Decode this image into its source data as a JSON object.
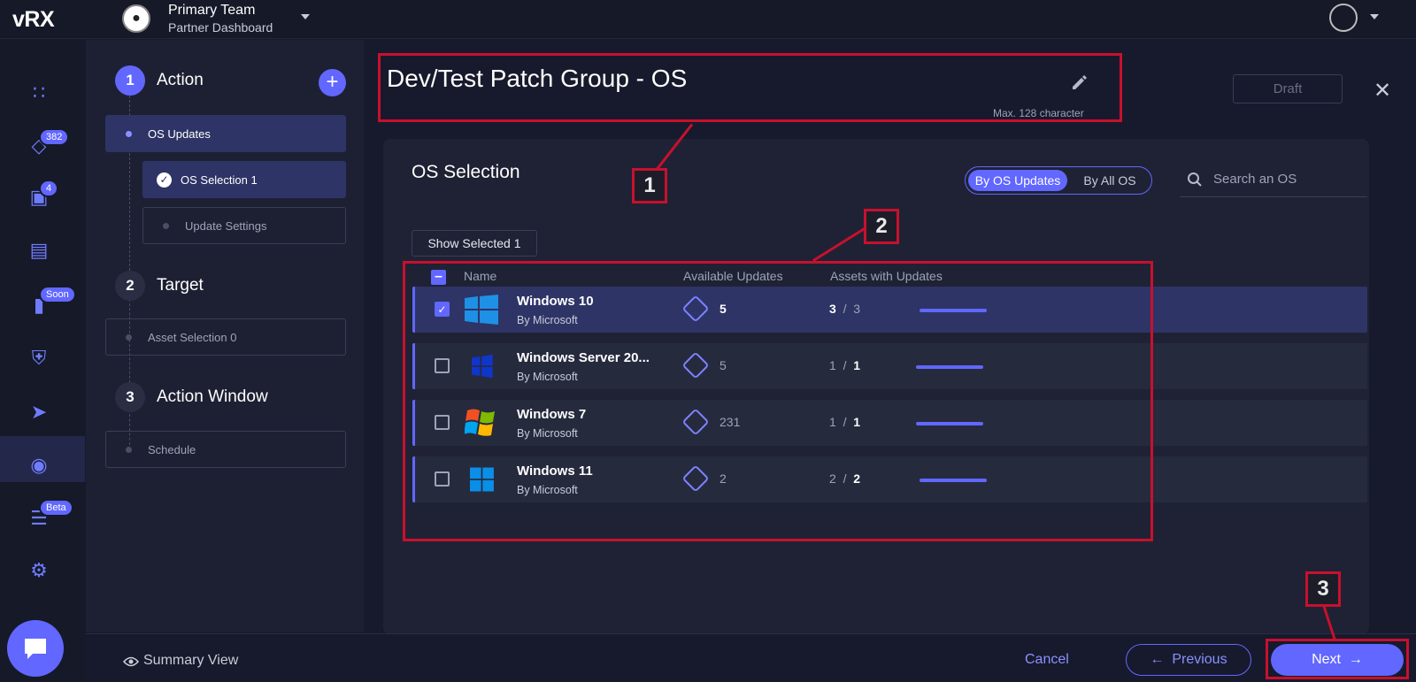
{
  "header": {
    "logo": "vRX",
    "team_name": "Primary Team",
    "team_subtitle": "Partner Dashboard"
  },
  "nav": {
    "badges": {
      "patches": "382",
      "devices": "4",
      "reports": "Soon",
      "history": "Beta"
    }
  },
  "steps": [
    {
      "number": "1",
      "title": "Action",
      "sub": [
        "OS Updates",
        "OS Selection 1",
        "Update Settings"
      ]
    },
    {
      "number": "2",
      "title": "Target",
      "sub": [
        "Asset Selection 0"
      ]
    },
    {
      "number": "3",
      "title": "Action Window",
      "sub": [
        "Schedule"
      ]
    }
  ],
  "main": {
    "title": "Dev/Test Patch Group - OS",
    "max_chars": "Max. 128 character",
    "draft_label": "Draft",
    "section_title": "OS Selection",
    "toggle": {
      "active": "By OS Updates",
      "inactive": "By All OS"
    },
    "search_placeholder": "Search an OS",
    "show_selected": "Show Selected 1",
    "columns": {
      "name": "Name",
      "available": "Available Updates",
      "assets": "Assets with Updates"
    },
    "rows": [
      {
        "name": "Windows 10",
        "vendor": "By Microsoft",
        "updates": "5",
        "assets_done": "3",
        "assets_total": "3",
        "selected": true,
        "progress": 1.0
      },
      {
        "name": "Windows Server 20...",
        "vendor": "By Microsoft",
        "updates": "5",
        "assets_done": "1",
        "assets_total": "1",
        "selected": false,
        "progress": 1.0
      },
      {
        "name": "Windows 7",
        "vendor": "By Microsoft",
        "updates": "231",
        "assets_done": "1",
        "assets_total": "1",
        "selected": false,
        "progress": 1.0
      },
      {
        "name": "Windows 11",
        "vendor": "By Microsoft",
        "updates": "2",
        "assets_done": "2",
        "assets_total": "2",
        "selected": false,
        "progress": 1.0
      }
    ]
  },
  "footer": {
    "summary": "Summary View",
    "cancel": "Cancel",
    "previous": "Previous",
    "next": "Next"
  },
  "annotations": [
    "1",
    "2",
    "3"
  ],
  "colors": {
    "accent": "#6167ff",
    "annotation": "#c8102e",
    "background": "#171a2c"
  }
}
